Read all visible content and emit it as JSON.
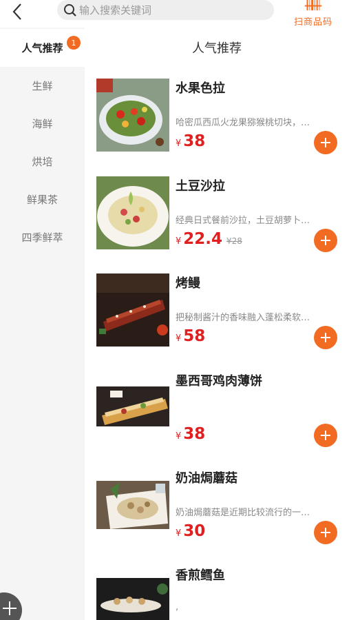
{
  "header": {
    "search_placeholder": "输入搜索关键词",
    "scan_label": "扫商品码"
  },
  "sidebar": {
    "items": [
      {
        "label": "人气推荐",
        "badge": "1"
      },
      {
        "label": "生鲜"
      },
      {
        "label": "海鲜"
      },
      {
        "label": "烘培"
      },
      {
        "label": "鲜果茶"
      },
      {
        "label": "四季鲜萃"
      }
    ]
  },
  "section_title": "人气推荐",
  "products": [
    {
      "name": "水果色拉",
      "desc": "哈密瓜西瓜火龙果猕猴桃切块，…",
      "currency": "¥",
      "price": "38",
      "old_price": ""
    },
    {
      "name": "土豆沙拉",
      "desc": "经典日式餐前沙拉，土豆胡萝卜…",
      "currency": "¥",
      "price": "22.4",
      "old_price": "¥28"
    },
    {
      "name": "烤鳗",
      "desc": "把秘制酱汁的香味融入蓬松柔软…",
      "currency": "¥",
      "price": "58",
      "old_price": ""
    },
    {
      "name": "墨西哥鸡肉薄饼",
      "desc": "",
      "currency": "¥",
      "price": "38",
      "old_price": ""
    },
    {
      "name": "奶油焗蘑菇",
      "desc": "奶油焗蘑菇是近期比较流行的一…",
      "currency": "¥",
      "price": "30",
      "old_price": ""
    },
    {
      "name": "香煎鳕鱼",
      "desc": ",",
      "currency": "",
      "price": "",
      "old_price": ""
    }
  ],
  "colors": {
    "accent": "#f26b22",
    "price": "#e02020"
  }
}
